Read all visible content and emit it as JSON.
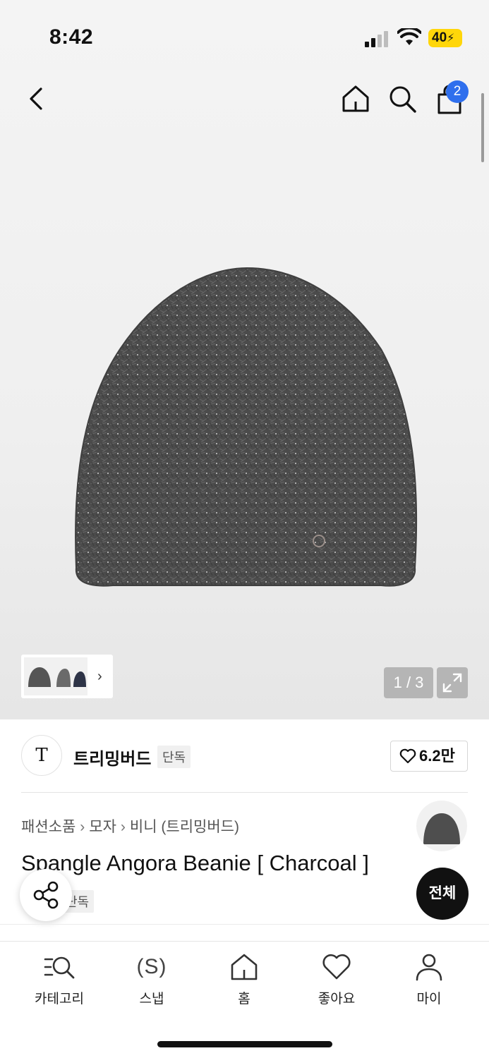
{
  "status_bar": {
    "time": "8:42",
    "battery": "40"
  },
  "nav": {
    "cart_count": "2",
    "icons": [
      "back-icon",
      "home-icon",
      "search-icon",
      "shopping-bag-icon"
    ]
  },
  "gallery": {
    "counter": "1 / 3",
    "thumbnails": 3
  },
  "brand": {
    "logo_letter": "T",
    "name": "트리밍버드",
    "exclusive_tag": "단독",
    "likes": "6.2만"
  },
  "breadcrumb": {
    "items": [
      "패션소품",
      "모자",
      "비니 (트리밍버드)"
    ]
  },
  "product": {
    "title": "Spangle Angora Beanie [ Charcoal ]",
    "exclusive_tag": "단독"
  },
  "buttons": {
    "all": "전체"
  },
  "tabbar": {
    "items": [
      {
        "label": "카테고리",
        "icon": "category-search-icon"
      },
      {
        "label": "스냅",
        "icon": "snap-icon",
        "glyph": "(S)"
      },
      {
        "label": "홈",
        "icon": "home-icon"
      },
      {
        "label": "좋아요",
        "icon": "heart-icon"
      },
      {
        "label": "마이",
        "icon": "person-icon"
      }
    ]
  },
  "colors": {
    "accent_badge": "#2f6fed",
    "battery": "#ffd60a",
    "beanie": "#4a4a4a"
  }
}
